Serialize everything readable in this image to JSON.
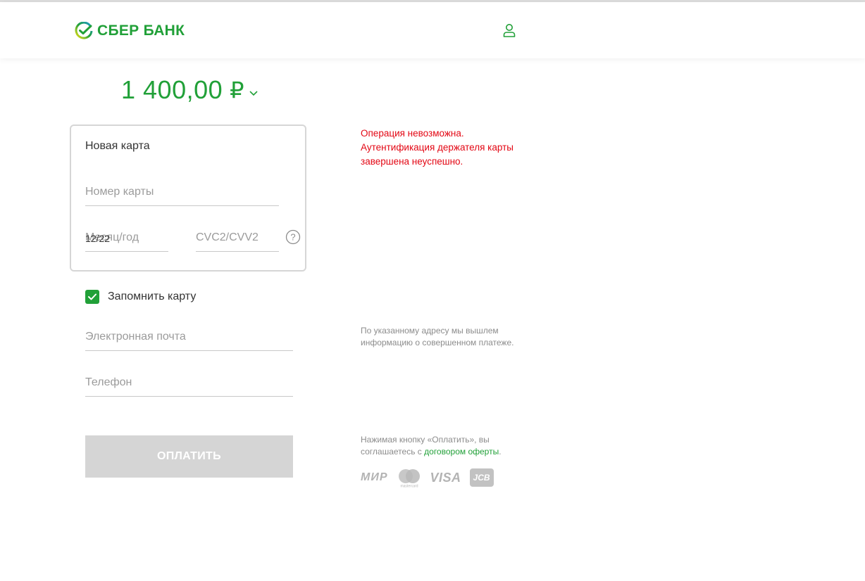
{
  "header": {
    "logo_text": "СБЕР БАНК",
    "user_icon": "user-icon"
  },
  "payment": {
    "amount": "1 400,00",
    "currency": "₽"
  },
  "card_form": {
    "title": "Новая карта",
    "card_number_placeholder": "Номер карты",
    "expiry_placeholder": "Месяц/год",
    "expiry_value": "12/22",
    "cvc_placeholder": "CVC2/CVV2",
    "help_icon": "question-circle-icon"
  },
  "error": {
    "line1": "Операция невозможна.",
    "line2": "Аутентификация держателя карты",
    "line3": "завершена неуспешно."
  },
  "remember": {
    "label": "Запомнить карту",
    "checked": true
  },
  "contacts": {
    "email_placeholder": "Электронная почта",
    "phone_placeholder": "Телефон",
    "email_note": "По указанному адресу мы вышлем информацию о совершенном платеже."
  },
  "pay": {
    "button_label": "ОПЛАТИТЬ",
    "offer_prefix": "Нажимая кнопку «Оплатить», вы соглашаетесь с ",
    "offer_link": "договором оферты",
    "offer_suffix": "."
  },
  "brands": {
    "mir": "МИР",
    "mastercard_caption": "mastercard",
    "visa": "VISA",
    "jcb": "JCB"
  },
  "colors": {
    "accent": "#21a038",
    "error": "#e30613",
    "disabled_button": "#d5d5d5"
  }
}
